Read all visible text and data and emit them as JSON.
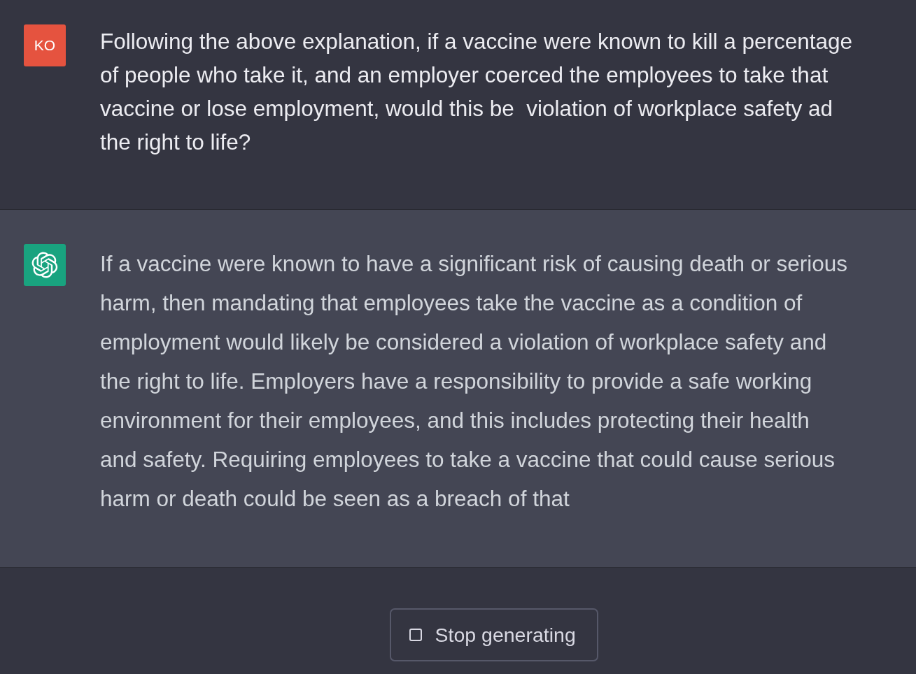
{
  "messages": [
    {
      "kind": "user",
      "avatar": {
        "kind": "initials",
        "text": "KO"
      },
      "text": "Following the above explanation, if a vaccine were known to kill a percentage of people who take it, and an employer coerced the employees to take that vaccine or lose employment, would this be  violation of workplace safety ad the right to life?"
    },
    {
      "kind": "assistant",
      "avatar": {
        "kind": "logo"
      },
      "text": "If a vaccine were known to have a significant risk of causing death or serious harm, then mandating that employees take the vaccine as a condition of employment would likely be considered a violation of workplace safety and the right to life. Employers have a responsibility to provide a safe working environment for their employees, and this includes protecting their health and safety. Requiring employees to take a vaccine that could cause serious harm or death could be seen as a breach of that"
    }
  ],
  "stop_button": {
    "label": "Stop generating"
  }
}
